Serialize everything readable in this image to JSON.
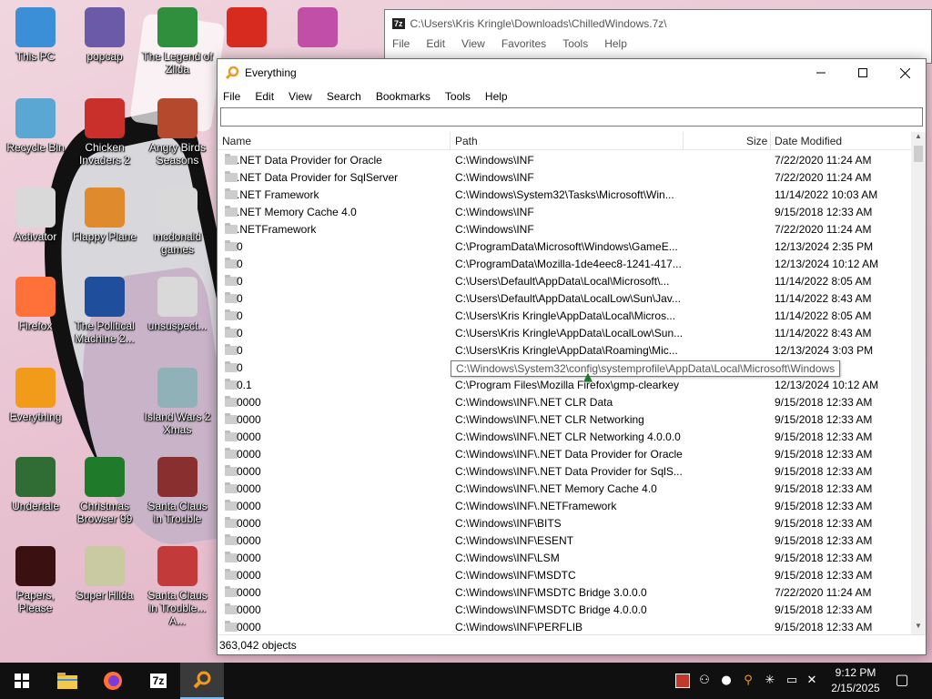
{
  "desktop": {
    "icons": [
      {
        "label": "This PC",
        "color": "#3b8fd6"
      },
      {
        "label": "popcap",
        "color": "#6b5aa8"
      },
      {
        "label": "The Legend of Zilda",
        "color": "#2f8f3c"
      },
      {
        "label": "",
        "color": "#d62b1e"
      },
      {
        "label": "",
        "color": "#c24fa7"
      },
      {
        "label": "Recycle Bin",
        "color": "#5aa7d4"
      },
      {
        "label": "Chicken Invaders 2",
        "color": "#c9302c"
      },
      {
        "label": "Angry Birds Seasons",
        "color": "#b5492e"
      },
      {
        "label": "Activator",
        "color": "#d9d9d9"
      },
      {
        "label": "Flappy Plane",
        "color": "#e08a2e"
      },
      {
        "label": "mcdonald games",
        "color": "#d9d9d9"
      },
      {
        "label": "Firefox",
        "color": "#ff7139"
      },
      {
        "label": "The Political Machine 2...",
        "color": "#1f4e9c"
      },
      {
        "label": "unsuspect...",
        "color": "#d9d9d9"
      },
      {
        "label": "Everything",
        "color": "#f29b1b"
      },
      {
        "label": "Island Wars 2 Xmas",
        "color": "#8fb1b7"
      },
      {
        "label": "Undertale",
        "color": "#2f6d35"
      },
      {
        "label": "Christmas Browser 99",
        "color": "#1f7a2a"
      },
      {
        "label": "Santa Claus in Trouble",
        "color": "#8a2f2f"
      },
      {
        "label": "Papers, Please",
        "color": "#3a1010"
      },
      {
        "label": "Super Hilda",
        "color": "#c9c9a2"
      },
      {
        "label": "Santa Claus in Trouble... A...",
        "color": "#c23a3a"
      }
    ]
  },
  "window_7z": {
    "icon_text": "7z",
    "title": "C:\\Users\\Kris Kringle\\Downloads\\ChilledWindows.7z\\",
    "menu": [
      "File",
      "Edit",
      "View",
      "Favorites",
      "Tools",
      "Help"
    ]
  },
  "everything": {
    "title": "Everything",
    "menu": [
      "File",
      "Edit",
      "View",
      "Search",
      "Bookmarks",
      "Tools",
      "Help"
    ],
    "search_value": "",
    "columns": {
      "name": "Name",
      "path": "Path",
      "size": "Size",
      "date": "Date Modified"
    },
    "rows": [
      {
        "name": ".NET Data Provider for Oracle",
        "path": "C:\\Windows\\INF",
        "size": "",
        "date": "7/22/2020 11:24 AM"
      },
      {
        "name": ".NET Data Provider for SqlServer",
        "path": "C:\\Windows\\INF",
        "size": "",
        "date": "7/22/2020 11:24 AM"
      },
      {
        "name": ".NET Framework",
        "path": "C:\\Windows\\System32\\Tasks\\Microsoft\\Win...",
        "size": "",
        "date": "11/14/2022 10:03 AM"
      },
      {
        "name": ".NET Memory Cache 4.0",
        "path": "C:\\Windows\\INF",
        "size": "",
        "date": "9/15/2018 12:33 AM"
      },
      {
        "name": ".NETFramework",
        "path": "C:\\Windows\\INF",
        "size": "",
        "date": "7/22/2020 11:24 AM"
      },
      {
        "name": "0",
        "path": "C:\\ProgramData\\Microsoft\\Windows\\GameE...",
        "size": "",
        "date": "12/13/2024 2:35 PM"
      },
      {
        "name": "0",
        "path": "C:\\ProgramData\\Mozilla-1de4eec8-1241-417...",
        "size": "",
        "date": "12/13/2024 10:12 AM"
      },
      {
        "name": "0",
        "path": "C:\\Users\\Default\\AppData\\Local\\Microsoft\\...",
        "size": "",
        "date": "11/14/2022 8:05 AM"
      },
      {
        "name": "0",
        "path": "C:\\Users\\Default\\AppData\\LocalLow\\Sun\\Jav...",
        "size": "",
        "date": "11/14/2022 8:43 AM"
      },
      {
        "name": "0",
        "path": "C:\\Users\\Kris Kringle\\AppData\\Local\\Micros...",
        "size": "",
        "date": "11/14/2022 8:05 AM"
      },
      {
        "name": "0",
        "path": "C:\\Users\\Kris Kringle\\AppData\\LocalLow\\Sun...",
        "size": "",
        "date": "11/14/2022 8:43 AM"
      },
      {
        "name": "0",
        "path": "C:\\Users\\Kris Kringle\\AppData\\Roaming\\Mic...",
        "size": "",
        "date": "12/13/2024 3:03 PM"
      },
      {
        "name": "0",
        "path": "",
        "size": "",
        "date": "4 AM"
      },
      {
        "name": "0.1",
        "path": "C:\\Program Files\\Mozilla Firefox\\gmp-clearkey",
        "size": "",
        "date": "12/13/2024 10:12 AM"
      },
      {
        "name": "0000",
        "path": "C:\\Windows\\INF\\.NET CLR Data",
        "size": "",
        "date": "9/15/2018 12:33 AM"
      },
      {
        "name": "0000",
        "path": "C:\\Windows\\INF\\.NET CLR Networking",
        "size": "",
        "date": "9/15/2018 12:33 AM"
      },
      {
        "name": "0000",
        "path": "C:\\Windows\\INF\\.NET CLR Networking 4.0.0.0",
        "size": "",
        "date": "9/15/2018 12:33 AM"
      },
      {
        "name": "0000",
        "path": "C:\\Windows\\INF\\.NET Data Provider for Oracle",
        "size": "",
        "date": "9/15/2018 12:33 AM"
      },
      {
        "name": "0000",
        "path": "C:\\Windows\\INF\\.NET Data Provider for SqlS...",
        "size": "",
        "date": "9/15/2018 12:33 AM"
      },
      {
        "name": "0000",
        "path": "C:\\Windows\\INF\\.NET Memory Cache 4.0",
        "size": "",
        "date": "9/15/2018 12:33 AM"
      },
      {
        "name": "0000",
        "path": "C:\\Windows\\INF\\.NETFramework",
        "size": "",
        "date": "9/15/2018 12:33 AM"
      },
      {
        "name": "0000",
        "path": "C:\\Windows\\INF\\BITS",
        "size": "",
        "date": "9/15/2018 12:33 AM"
      },
      {
        "name": "0000",
        "path": "C:\\Windows\\INF\\ESENT",
        "size": "",
        "date": "9/15/2018 12:33 AM"
      },
      {
        "name": "0000",
        "path": "C:\\Windows\\INF\\LSM",
        "size": "",
        "date": "9/15/2018 12:33 AM"
      },
      {
        "name": "0000",
        "path": "C:\\Windows\\INF\\MSDTC",
        "size": "",
        "date": "9/15/2018 12:33 AM"
      },
      {
        "name": "0000",
        "path": "C:\\Windows\\INF\\MSDTC Bridge 3.0.0.0",
        "size": "",
        "date": "7/22/2020 11:24 AM"
      },
      {
        "name": "0000",
        "path": "C:\\Windows\\INF\\MSDTC Bridge 4.0.0.0",
        "size": "",
        "date": "9/15/2018 12:33 AM"
      },
      {
        "name": "0000",
        "path": "C:\\Windows\\INF\\PERFLIB",
        "size": "",
        "date": "9/15/2018 12:33 AM"
      }
    ],
    "tooltip": "C:\\Windows\\System32\\config\\systemprofile\\AppData\\Local\\Microsoft\\Windows",
    "status": "363,042 objects"
  },
  "taskbar": {
    "apps": [
      {
        "name": "file-explorer",
        "icon": "folder-icon",
        "color": "#f3c94c"
      },
      {
        "name": "firefox",
        "icon": "firefox-icon",
        "color": "#ff7139"
      },
      {
        "name": "7-zip",
        "icon": "7zip-icon",
        "color": "#ffffff",
        "text": "7z"
      },
      {
        "name": "everything",
        "icon": "magnifier-icon",
        "color": "#f29b1b"
      }
    ],
    "time": "9:12 PM",
    "date": "2/15/2025"
  }
}
